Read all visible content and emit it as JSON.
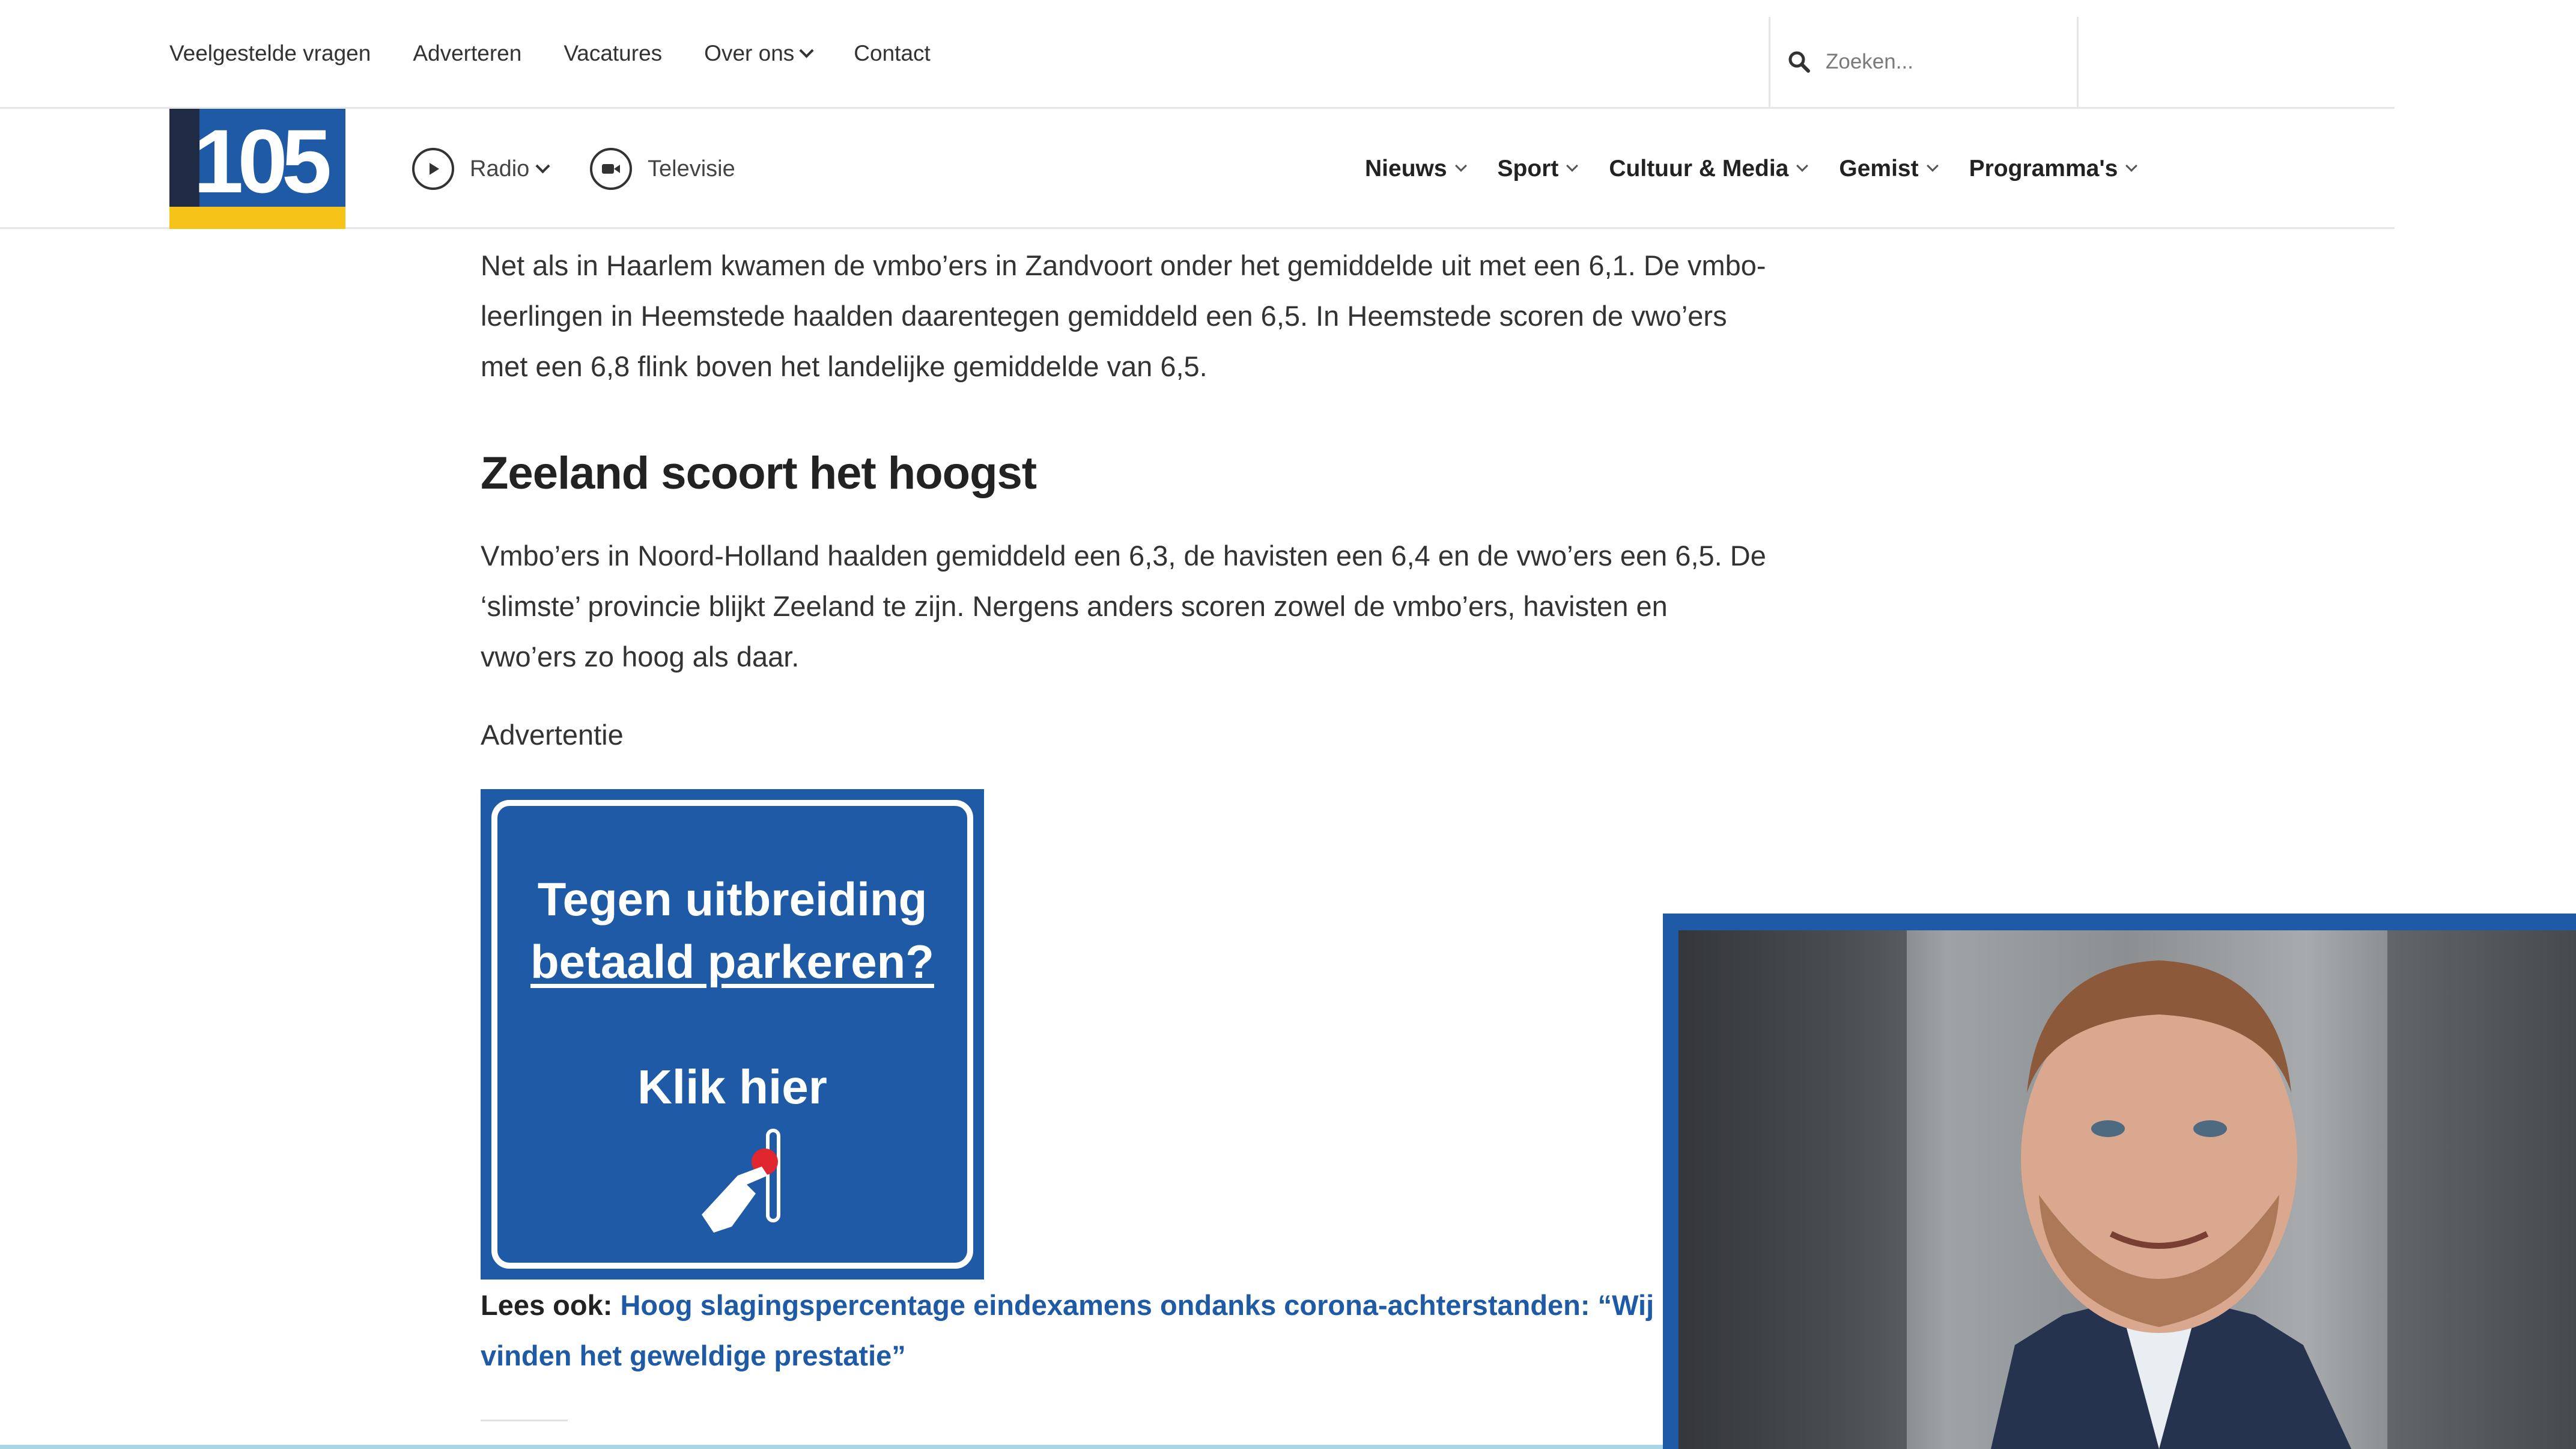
{
  "topbar": {
    "links": [
      "Veelgestelde vragen",
      "Adverteren",
      "Vacatures",
      "Over ons",
      "Contact"
    ],
    "search_placeholder": "Zoeken..."
  },
  "header": {
    "logo_text": "105",
    "radio_label": "Radio",
    "tv_label": "Televisie",
    "nav": [
      "Nieuws",
      "Sport",
      "Cultuur & Media",
      "Gemist",
      "Programma's"
    ]
  },
  "article": {
    "para1": "Net als in Haarlem kwamen de vmbo’ers in Zandvoort onder het gemiddelde uit met een 6,1. De vmbo-leerlingen in Heemstede haalden daarentegen gemiddeld een 6,5. In Heemstede scoren de vwo’ers met een 6,8 flink boven het landelijke gemiddelde van 6,5.",
    "heading": "Zeeland scoort het hoogst",
    "para2": "Vmbo’ers in Noord-Holland haalden gemiddeld een 6,3, de havisten een 6,4 en de vwo’ers een 6,5. De ‘slimste’ provincie blijkt Zeeland te zijn. Nergens anders scoren zowel de vmbo’ers, havisten en vwo’ers zo hoog als daar.",
    "ad_label": "Advertentie",
    "ad": {
      "line1": "Tegen uitbreiding",
      "line2": "betaald parkeren?",
      "line3": "Klik hier"
    },
    "lees_prefix": "Lees ook:",
    "lees_link": "Hoog slagingspercentage eindexamens ondanks corona-achterstanden: “Wij vinden het geweldige prestatie”"
  },
  "colors": {
    "brand_blue": "#1e5aa6",
    "brand_dark": "#1f2a44",
    "brand_yellow": "#f6c319"
  }
}
